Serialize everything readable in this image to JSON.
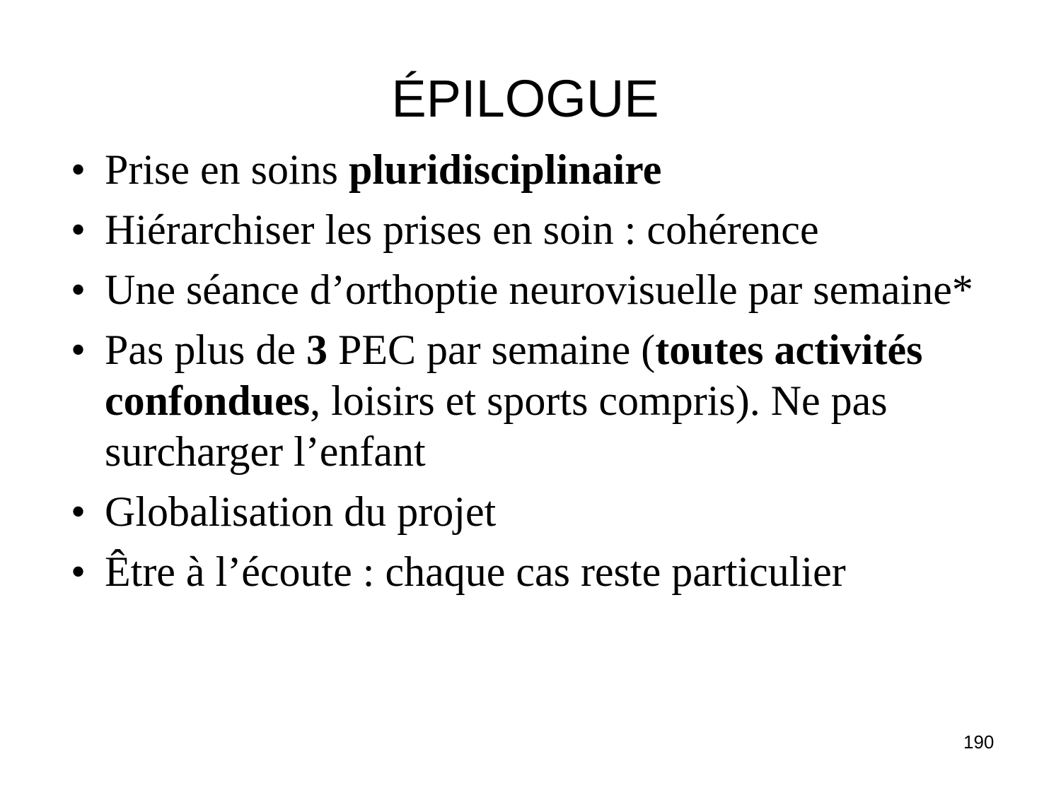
{
  "slide": {
    "title": "ÉPILOGUE",
    "bullet_symbol": "•",
    "items": [
      {
        "segments": [
          {
            "text": "Prise en soins ",
            "bold": false
          },
          {
            "text": "pluridisciplinaire",
            "bold": true
          }
        ]
      },
      {
        "segments": [
          {
            "text": "Hiérarchiser les prises en soin : cohérence",
            "bold": false
          }
        ]
      },
      {
        "segments": [
          {
            "text": "Une séance d’orthoptie neurovisuelle par semaine*",
            "bold": false
          }
        ]
      },
      {
        "segments": [
          {
            "text": "Pas plus de ",
            "bold": false
          },
          {
            "text": "3",
            "bold": true
          },
          {
            "text": " PEC par semaine (",
            "bold": false
          },
          {
            "text": "toutes activités confondues",
            "bold": true
          },
          {
            "text": ", loisirs et sports compris). Ne pas surcharger l’enfant",
            "bold": false
          }
        ]
      },
      {
        "segments": [
          {
            "text": "Globalisation du projet",
            "bold": false
          }
        ]
      },
      {
        "segments": [
          {
            "text": "Être à l’écoute : chaque cas reste particulier",
            "bold": false
          }
        ]
      }
    ],
    "page_number": "190"
  }
}
